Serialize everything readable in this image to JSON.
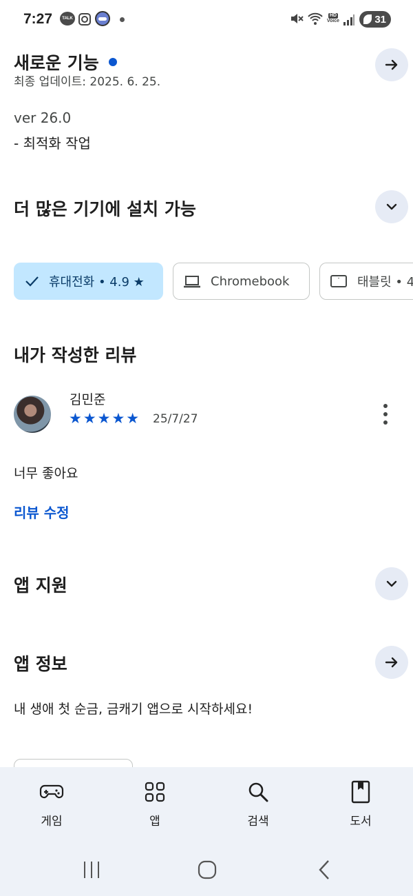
{
  "status_bar": {
    "time": "7:27",
    "talk_badge": "TALK",
    "hd_label": "HD",
    "voice_label": "Voice",
    "battery": "31"
  },
  "whats_new": {
    "title": "새로운 기능",
    "updated": "최종 업데이트: 2025. 6. 25.",
    "version": "ver 26.0",
    "note": "- 최적화 작업"
  },
  "devices": {
    "title": "더 많은 기기에 설치 가능",
    "chips": [
      {
        "label": "휴대전화 • 4.9 ★",
        "selected": true
      },
      {
        "label": "Chromebook",
        "selected": false
      },
      {
        "label": "태블릿 • 4",
        "selected": false
      }
    ]
  },
  "my_review": {
    "title": "내가 작성한 리뷰",
    "reviewer": "김민준",
    "rating": 5,
    "stars": "★★★★★",
    "date": "25/7/27",
    "text": "너무 좋아요",
    "edit_label": "리뷰 수정"
  },
  "app_support": {
    "title": "앱 지원"
  },
  "app_info": {
    "title": "앱 정보",
    "description": "내 생애 첫 순금, 금캐기 앱으로 시작하세요!"
  },
  "bottom_nav": {
    "items": [
      {
        "label": "게임",
        "icon": "gamepad-icon"
      },
      {
        "label": "앱",
        "icon": "apps-grid-icon"
      },
      {
        "label": "검색",
        "icon": "search-icon"
      },
      {
        "label": "도서",
        "icon": "book-icon"
      }
    ]
  },
  "colors": {
    "accent": "#0b57d0",
    "chip_selected_bg": "#c2e7ff",
    "round_button_bg": "#e6ebf5",
    "nav_bg": "#eef2f8"
  }
}
